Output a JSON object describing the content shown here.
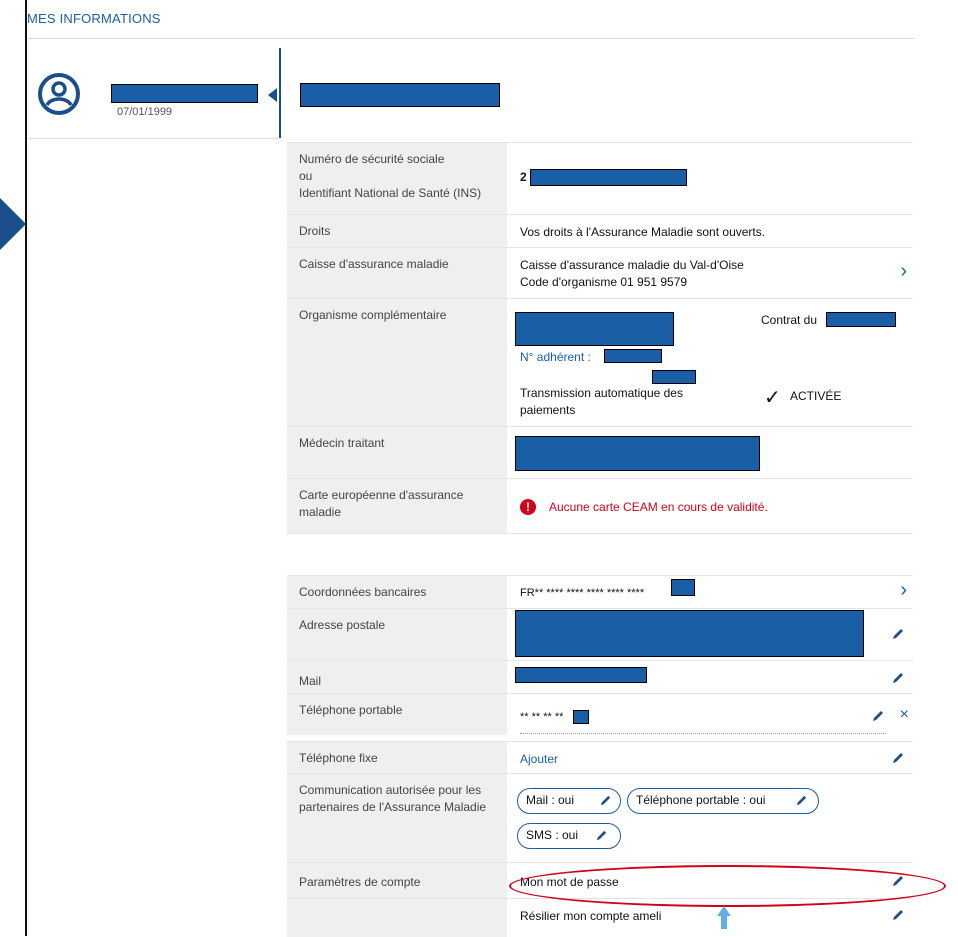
{
  "header": {
    "title": "MES INFORMATIONS"
  },
  "profile": {
    "birthdate": "07/01/1999",
    "avatar_icon": "user-circle-icon"
  },
  "rows": {
    "nss": {
      "label_line1": "Numéro de sécurité sociale",
      "label_line2": "ou",
      "label_line3": "Identifiant National de Santé (INS)",
      "value_prefix": "2"
    },
    "droits": {
      "label": "Droits",
      "value": "Vos droits à l'Assurance Maladie sont ouverts."
    },
    "caisse": {
      "label": "Caisse d'assurance maladie",
      "value_line1": "Caisse d'assurance maladie du Val-d'Oise",
      "value_line2": "Code d'organisme 01 951 9579"
    },
    "complementaire": {
      "label": "Organisme complémentaire",
      "contrat": "Contrat du",
      "adherent": "N° adhérent :",
      "transmission": "Transmission automatique des paiements",
      "status": "ACTIVÉE"
    },
    "medecin": {
      "label": "Médecin traitant"
    },
    "ceam": {
      "label": "Carte européenne d'assurance maladie",
      "value": "Aucune carte CEAM en cours de validité."
    },
    "banque": {
      "label": "Coordonnées bancaires",
      "value": "FR** **** **** **** **** ****"
    },
    "adresse": {
      "label": "Adresse postale"
    },
    "mail": {
      "label": "Mail"
    },
    "portable": {
      "label": "Téléphone portable",
      "value": "** ** ** **"
    },
    "fixe": {
      "label": "Téléphone fixe",
      "value": "Ajouter"
    },
    "communication": {
      "label": "Communication autorisée pour les partenaires de l'Assurance Maladie",
      "pill_mail": "Mail : oui",
      "pill_tel": "Téléphone portable : oui",
      "pill_sms": "SMS : oui"
    },
    "parametres": {
      "label": "Paramètres de compte",
      "password": "Mon mot de passe",
      "resilier": "Résilier mon compte ameli"
    }
  },
  "colors": {
    "accent": "#1a5fa6",
    "alert": "#d0021b",
    "label_bg": "#efefef"
  }
}
